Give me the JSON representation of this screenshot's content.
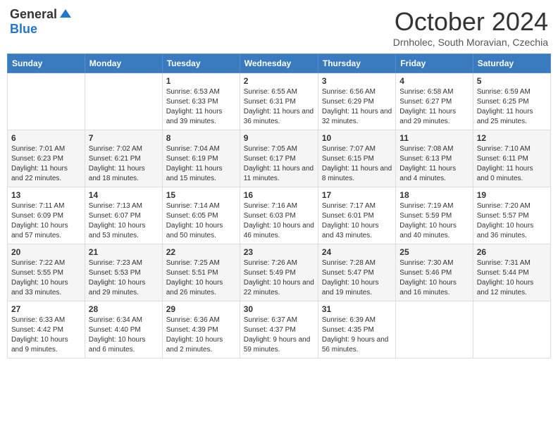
{
  "header": {
    "logo_general": "General",
    "logo_blue": "Blue",
    "month_title": "October 2024",
    "subtitle": "Drnholec, South Moravian, Czechia"
  },
  "days_of_week": [
    "Sunday",
    "Monday",
    "Tuesday",
    "Wednesday",
    "Thursday",
    "Friday",
    "Saturday"
  ],
  "weeks": [
    [
      {
        "day": "",
        "info": ""
      },
      {
        "day": "",
        "info": ""
      },
      {
        "day": "1",
        "info": "Sunrise: 6:53 AM\nSunset: 6:33 PM\nDaylight: 11 hours and 39 minutes."
      },
      {
        "day": "2",
        "info": "Sunrise: 6:55 AM\nSunset: 6:31 PM\nDaylight: 11 hours and 36 minutes."
      },
      {
        "day": "3",
        "info": "Sunrise: 6:56 AM\nSunset: 6:29 PM\nDaylight: 11 hours and 32 minutes."
      },
      {
        "day": "4",
        "info": "Sunrise: 6:58 AM\nSunset: 6:27 PM\nDaylight: 11 hours and 29 minutes."
      },
      {
        "day": "5",
        "info": "Sunrise: 6:59 AM\nSunset: 6:25 PM\nDaylight: 11 hours and 25 minutes."
      }
    ],
    [
      {
        "day": "6",
        "info": "Sunrise: 7:01 AM\nSunset: 6:23 PM\nDaylight: 11 hours and 22 minutes."
      },
      {
        "day": "7",
        "info": "Sunrise: 7:02 AM\nSunset: 6:21 PM\nDaylight: 11 hours and 18 minutes."
      },
      {
        "day": "8",
        "info": "Sunrise: 7:04 AM\nSunset: 6:19 PM\nDaylight: 11 hours and 15 minutes."
      },
      {
        "day": "9",
        "info": "Sunrise: 7:05 AM\nSunset: 6:17 PM\nDaylight: 11 hours and 11 minutes."
      },
      {
        "day": "10",
        "info": "Sunrise: 7:07 AM\nSunset: 6:15 PM\nDaylight: 11 hours and 8 minutes."
      },
      {
        "day": "11",
        "info": "Sunrise: 7:08 AM\nSunset: 6:13 PM\nDaylight: 11 hours and 4 minutes."
      },
      {
        "day": "12",
        "info": "Sunrise: 7:10 AM\nSunset: 6:11 PM\nDaylight: 11 hours and 0 minutes."
      }
    ],
    [
      {
        "day": "13",
        "info": "Sunrise: 7:11 AM\nSunset: 6:09 PM\nDaylight: 10 hours and 57 minutes."
      },
      {
        "day": "14",
        "info": "Sunrise: 7:13 AM\nSunset: 6:07 PM\nDaylight: 10 hours and 53 minutes."
      },
      {
        "day": "15",
        "info": "Sunrise: 7:14 AM\nSunset: 6:05 PM\nDaylight: 10 hours and 50 minutes."
      },
      {
        "day": "16",
        "info": "Sunrise: 7:16 AM\nSunset: 6:03 PM\nDaylight: 10 hours and 46 minutes."
      },
      {
        "day": "17",
        "info": "Sunrise: 7:17 AM\nSunset: 6:01 PM\nDaylight: 10 hours and 43 minutes."
      },
      {
        "day": "18",
        "info": "Sunrise: 7:19 AM\nSunset: 5:59 PM\nDaylight: 10 hours and 40 minutes."
      },
      {
        "day": "19",
        "info": "Sunrise: 7:20 AM\nSunset: 5:57 PM\nDaylight: 10 hours and 36 minutes."
      }
    ],
    [
      {
        "day": "20",
        "info": "Sunrise: 7:22 AM\nSunset: 5:55 PM\nDaylight: 10 hours and 33 minutes."
      },
      {
        "day": "21",
        "info": "Sunrise: 7:23 AM\nSunset: 5:53 PM\nDaylight: 10 hours and 29 minutes."
      },
      {
        "day": "22",
        "info": "Sunrise: 7:25 AM\nSunset: 5:51 PM\nDaylight: 10 hours and 26 minutes."
      },
      {
        "day": "23",
        "info": "Sunrise: 7:26 AM\nSunset: 5:49 PM\nDaylight: 10 hours and 22 minutes."
      },
      {
        "day": "24",
        "info": "Sunrise: 7:28 AM\nSunset: 5:47 PM\nDaylight: 10 hours and 19 minutes."
      },
      {
        "day": "25",
        "info": "Sunrise: 7:30 AM\nSunset: 5:46 PM\nDaylight: 10 hours and 16 minutes."
      },
      {
        "day": "26",
        "info": "Sunrise: 7:31 AM\nSunset: 5:44 PM\nDaylight: 10 hours and 12 minutes."
      }
    ],
    [
      {
        "day": "27",
        "info": "Sunrise: 6:33 AM\nSunset: 4:42 PM\nDaylight: 10 hours and 9 minutes."
      },
      {
        "day": "28",
        "info": "Sunrise: 6:34 AM\nSunset: 4:40 PM\nDaylight: 10 hours and 6 minutes."
      },
      {
        "day": "29",
        "info": "Sunrise: 6:36 AM\nSunset: 4:39 PM\nDaylight: 10 hours and 2 minutes."
      },
      {
        "day": "30",
        "info": "Sunrise: 6:37 AM\nSunset: 4:37 PM\nDaylight: 9 hours and 59 minutes."
      },
      {
        "day": "31",
        "info": "Sunrise: 6:39 AM\nSunset: 4:35 PM\nDaylight: 9 hours and 56 minutes."
      },
      {
        "day": "",
        "info": ""
      },
      {
        "day": "",
        "info": ""
      }
    ]
  ]
}
